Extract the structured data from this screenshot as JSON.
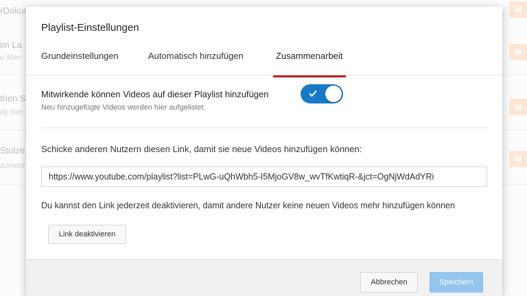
{
  "background": {
    "rows": [
      {
        "title": "rDokuChannel",
        "sub": "",
        "badge": "M"
      },
      {
        "title": "im La",
        "sub": "u Man",
        "badge": "M"
      },
      {
        "title": "then S",
        "sub": "dy han",
        "badge": "M"
      },
      {
        "title": "Stolze",
        "sub": "zument",
        "badge": "M"
      }
    ]
  },
  "dialog": {
    "title": "Playlist-Einstellungen",
    "tabs": [
      {
        "label": "Grundeinstellungen",
        "active": false
      },
      {
        "label": "Automatisch hinzufügen",
        "active": false
      },
      {
        "label": "Zusammenarbeit",
        "active": true
      }
    ],
    "collab": {
      "toggle_label": "Mitwirkende können Videos auf dieser Playlist hinzufügen",
      "toggle_sub": "Neu hinzugefügte Videos werden hier aufgelistet.",
      "toggle_on": true,
      "share_text": "Schicke anderen Nutzern diesen Link, damit sie neue Videos hinzufügen können:",
      "link_value": "https://www.youtube.com/playlist?list=PLwG-uQhWbh5-I5MjoGV8w_wvTfKwtiqR-&jct=OgNjWdAdYRi",
      "deactivate_text": "Du kannst den Link jederzeit deaktivieren, damit andere Nutzer keine neuen Videos mehr hinzufügen können",
      "deactivate_button": "Link deaktivieren"
    },
    "footer": {
      "cancel_label": "Abbrechen",
      "save_label": "Speichern"
    }
  },
  "colors": {
    "accent_blue": "#167ac6",
    "tab_underline_red": "#cc181e",
    "save_disabled": "#95c4ee",
    "badge_orange": "#fbd9bf"
  }
}
